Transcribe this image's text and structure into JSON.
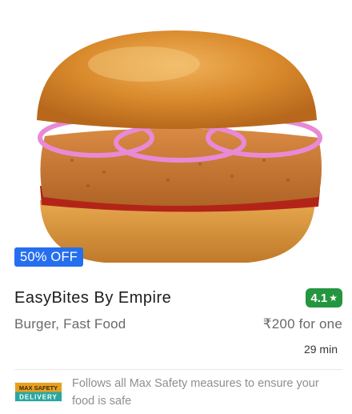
{
  "restaurant": {
    "name": "EasyBites By Empire",
    "rating": "4.1",
    "rating_icon": "star-icon",
    "cuisines": "Burger, Fast Food",
    "price": "₹200 for one",
    "delivery_time": "29 min",
    "image_subject": "burger-image",
    "offer": "50% OFF"
  },
  "safety": {
    "logo_line1": "MAX SAFETY",
    "logo_line2": "DELIVERY",
    "text": "Follows all Max Safety measures to ensure your food is safe"
  },
  "colors": {
    "offer_badge": "#256fef",
    "rating_badge": "#24963f",
    "primary_text": "#1c1c1c",
    "secondary_text": "#696969",
    "muted_text": "#8f8f8f"
  }
}
